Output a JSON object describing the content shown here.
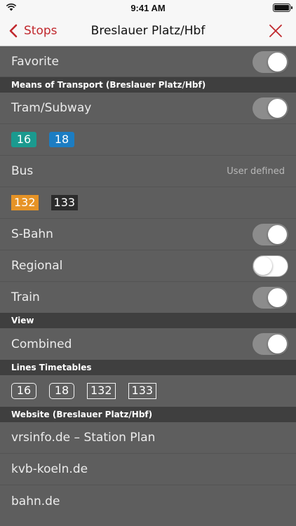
{
  "status": {
    "time": "9:41 AM"
  },
  "nav": {
    "back_label": "Stops",
    "title": "Breslauer Platz/Hbf"
  },
  "favorite": {
    "label": "Favorite",
    "on": true
  },
  "sections": {
    "transport": "Means of Transport (Breslauer Platz/Hbf)",
    "view": "View",
    "timetables": "Lines Timetables",
    "website": "Website (Breslauer Platz/Hbf)"
  },
  "transport": {
    "tram": {
      "label": "Tram/Subway",
      "on": true,
      "lines": [
        "16",
        "18"
      ]
    },
    "bus": {
      "label": "Bus",
      "mode": "User defined",
      "lines": [
        "132",
        "133"
      ]
    },
    "sbahn": {
      "label": "S-Bahn",
      "on": true
    },
    "regional": {
      "label": "Regional",
      "on": false
    },
    "train": {
      "label": "Train",
      "on": true
    }
  },
  "view": {
    "label": "Combined",
    "on": true
  },
  "timetables": {
    "lines": [
      "16",
      "18",
      "132",
      "133"
    ]
  },
  "websites": [
    "vrsinfo.de – Station Plan",
    "kvb-koeln.de",
    "bahn.de"
  ],
  "colors": {
    "accent": "#c0282d",
    "tram16": "#1b9a8f",
    "tram18": "#1c7dc3",
    "bus132": "#e69326",
    "bus133": "#2b2b2b"
  }
}
